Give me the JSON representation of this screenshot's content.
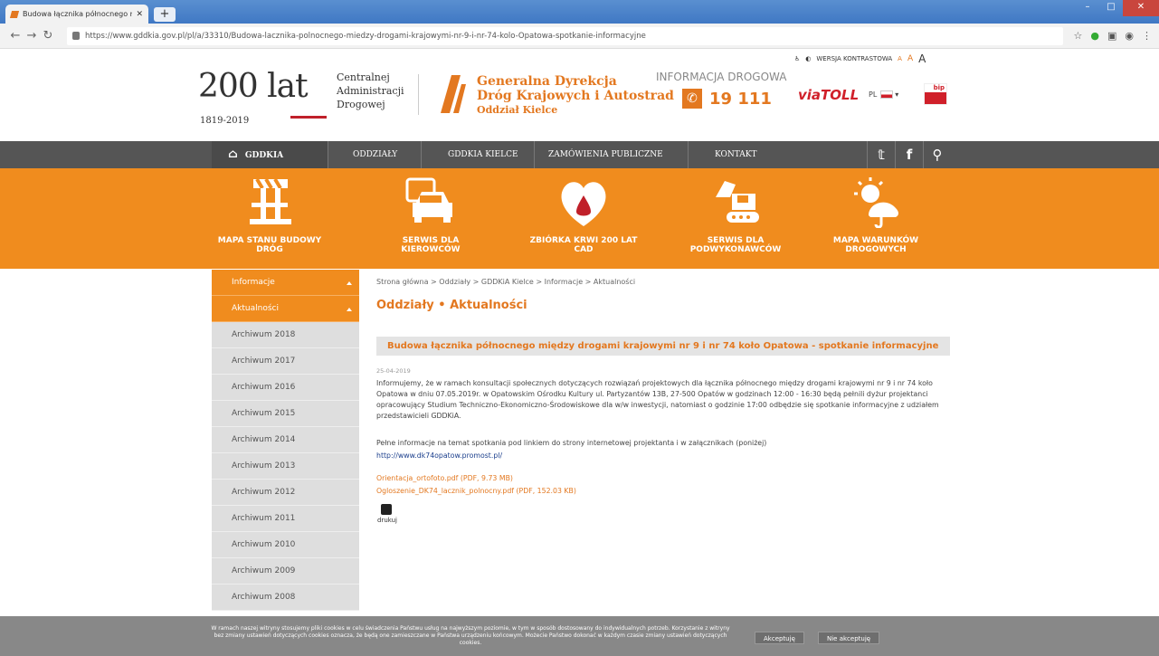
{
  "browser": {
    "tab_title": "Budowa łącznika północnego m",
    "url": "https://www.gddkia.gov.pl/pl/a/33310/Budowa-lacznika-polnocnego-miedzy-drogami-krajowymi-nr-9-i-nr-74-kolo-Opatowa-spotkanie-informacyjne"
  },
  "header": {
    "years_big": "200 lat",
    "years_range": "1819-2019",
    "cad": [
      "Centralnej",
      "Administracji",
      "Drogowej"
    ],
    "gddkia": [
      "Generalna Dyrekcja",
      "Dróg Krajowych i Autostrad"
    ],
    "branch": "Oddział Kielce",
    "info_label": "INFORMACJA DROGOWA",
    "phone": "19 111",
    "contrast": "WERSJA KONTRASTOWA",
    "a_small": "A",
    "a_mid": "A",
    "a_big": "A",
    "viatoll": "viaTOLL",
    "lang": "PL",
    "bip": "bip"
  },
  "nav": {
    "home": "GDDKIA",
    "items": [
      "ODDZIAŁY",
      "GDDKIA KIELCE",
      "ZAMÓWIENIA PUBLICZNE",
      "KONTAKT"
    ]
  },
  "services": [
    {
      "label": "MAPA STANU BUDOWY DRÓG",
      "icon": "road-barrier-icon"
    },
    {
      "label": "SERWIS DLA KIEROWCÓW",
      "icon": "cars-icon"
    },
    {
      "label": "ZBIÓRKA KRWI 200 lat CAD",
      "icon": "blood-drop-icon"
    },
    {
      "label": "SERWIS DLA PODWYKONAWCÓW",
      "icon": "excavator-icon"
    },
    {
      "label": "MAPA WARUNKÓW DROGOWYCH",
      "icon": "weather-icon"
    }
  ],
  "sidebar": {
    "items": [
      "Informacje",
      "Aktualności",
      "Archiwum 2018",
      "Archiwum 2017",
      "Archiwum 2016",
      "Archiwum 2015",
      "Archiwum 2014",
      "Archiwum 2013",
      "Archiwum 2012",
      "Archiwum 2011",
      "Archiwum 2010",
      "Archiwum 2009",
      "Archiwum 2008"
    ]
  },
  "content": {
    "breadcrumb": "Strona główna > Oddziały > GDDKiA Kielce > Informacje > Aktualności",
    "page_title": "Oddziały • Aktualności",
    "headline": "Budowa łącznika północnego między drogami krajowymi nr 9 i nr 74 koło Opatowa - spotkanie informacyjne",
    "date": "25-04-2019",
    "body": "Informujemy, że w ramach konsultacji społecznych dotyczących rozwiązań projektowych dla łącznika północnego między drogami krajowymi nr 9 i nr 74 koło Opatowa w dniu 07.05.2019r. w Opatowskim Ośrodku Kultury ul. Partyzantów 13B, 27-500 Opatów w godzinach 12:00 - 16:30 będą pełnili dyżur projektanci opracowujący Studium Techniczno-Ekonomiczno-Środowiskowe dla w/w inwestycji, natomiast o godzinie 17:00 odbędzie się spotkanie informacyjne z udziałem przedstawicieli GDDKiA.",
    "para2": "Pełne informacje na temat spotkania pod linkiem do strony internetowej projektanta i w załącznikach (poniżej)",
    "link": "http://www.dk74opatow.promost.pl/",
    "att1": "Orientacja_ortofoto.pdf (PDF, 9.73 MB)",
    "att2": "Ogloszenie_DK74_lacznik_polnocny.pdf (PDF, 152.03 KB)",
    "print": "drukuj"
  },
  "cookie": {
    "text": "W ramach naszej witryny stosujemy pliki cookies w celu świadczenia Państwu usług na najwyższym poziomie, w tym w sposób dostosowany do indywidualnych potrzeb. Korzystanie z witryny bez zmiany ustawień dotyczących cookies oznacza, że będą one zamieszczane w Państwa urządzeniu końcowym. Możecie Państwo dokonać w każdym czasie zmiany ustawień dotyczących cookies.",
    "accept": "Akceptuję",
    "reject": "Nie akceptuję"
  }
}
